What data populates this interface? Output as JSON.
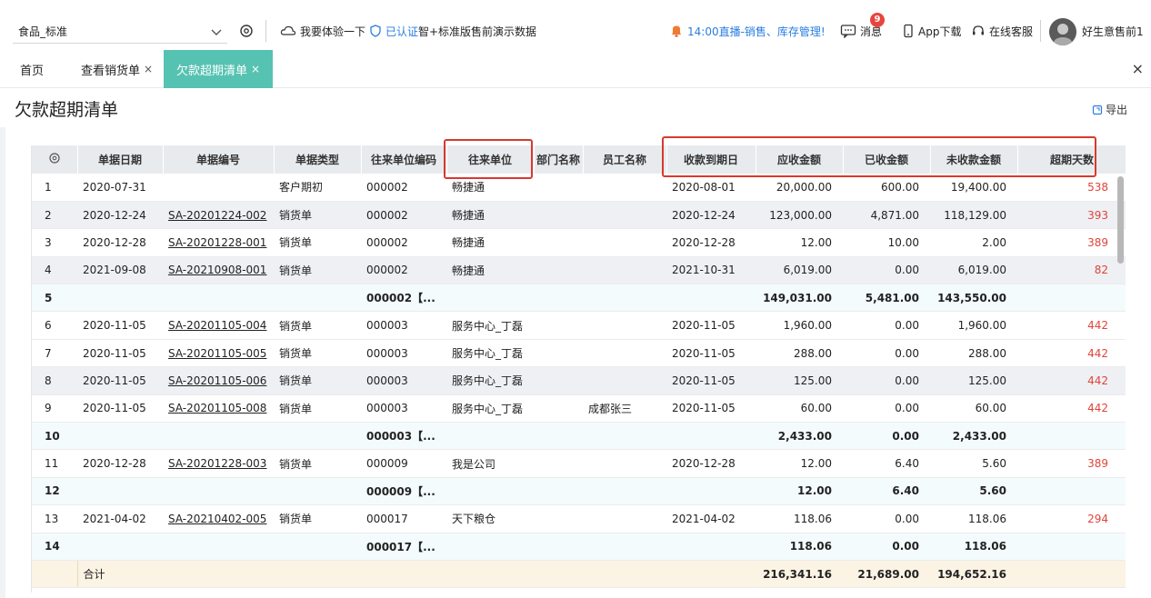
{
  "header": {
    "store_name": "食品_标准",
    "trial": "我要体验一下",
    "certified": "已认证",
    "version": "智+标准版售前演示数据",
    "notice": "14:00直播-销售、库存管理!",
    "messages": "消息",
    "messages_badge": "9",
    "app_download": "App下载",
    "online_service": "在线客服",
    "user_name": "好生意售前1"
  },
  "tabs": [
    {
      "label": "首页"
    },
    {
      "label": "查看销货单",
      "close": "×"
    },
    {
      "label": "欠款超期清单",
      "close": "×"
    }
  ],
  "tabs_close_all": "×",
  "page": {
    "title": "欠款超期清单",
    "export": "导出"
  },
  "table": {
    "columns": [
      "单据日期",
      "单据编号",
      "单据类型",
      "往来单位编码",
      "往来单位",
      "部门名称",
      "员工名称",
      "收款到期日",
      "应收金额",
      "已收金额",
      "未收款金额",
      "超期天数"
    ],
    "rows": [
      {
        "no": "1",
        "date": "2020-07-31",
        "code": "",
        "type": "客户期初",
        "unit_code": "000002",
        "unit": "畅捷通",
        "dept": "",
        "emp": "",
        "due": "2020-08-01",
        "receivable": "20,000.00",
        "received": "600.00",
        "unreceived": "19,400.00",
        "days": "538",
        "kind": "odd"
      },
      {
        "no": "2",
        "date": "2020-12-24",
        "code": "SA-20201224-002",
        "type": "销货单",
        "unit_code": "000002",
        "unit": "畅捷通",
        "dept": "",
        "emp": "",
        "due": "2020-12-24",
        "receivable": "123,000.00",
        "received": "4,871.00",
        "unreceived": "118,129.00",
        "days": "393",
        "kind": "even"
      },
      {
        "no": "3",
        "date": "2020-12-28",
        "code": "SA-20201228-001",
        "type": "销货单",
        "unit_code": "000002",
        "unit": "畅捷通",
        "dept": "",
        "emp": "",
        "due": "2020-12-28",
        "receivable": "12.00",
        "received": "10.00",
        "unreceived": "2.00",
        "days": "389",
        "kind": "odd"
      },
      {
        "no": "4",
        "date": "2021-09-08",
        "code": "SA-20210908-001",
        "type": "销货单",
        "unit_code": "000002",
        "unit": "畅捷通",
        "dept": "",
        "emp": "",
        "due": "2021-10-31",
        "receivable": "6,019.00",
        "received": "0.00",
        "unreceived": "6,019.00",
        "days": "82",
        "kind": "even"
      },
      {
        "no": "5",
        "date": "",
        "code": "",
        "type": "",
        "unit_code": "000002【...",
        "unit": "",
        "dept": "",
        "emp": "",
        "due": "",
        "receivable": "149,031.00",
        "received": "5,481.00",
        "unreceived": "143,550.00",
        "days": "",
        "kind": "sub"
      },
      {
        "no": "6",
        "date": "2020-11-05",
        "code": "SA-20201105-004",
        "type": "销货单",
        "unit_code": "000003",
        "unit": "服务中心_丁磊",
        "dept": "",
        "emp": "",
        "due": "2020-11-05",
        "receivable": "1,960.00",
        "received": "0.00",
        "unreceived": "1,960.00",
        "days": "442",
        "kind": "odd"
      },
      {
        "no": "7",
        "date": "2020-11-05",
        "code": "SA-20201105-005",
        "type": "销货单",
        "unit_code": "000003",
        "unit": "服务中心_丁磊",
        "dept": "",
        "emp": "",
        "due": "2020-11-05",
        "receivable": "288.00",
        "received": "0.00",
        "unreceived": "288.00",
        "days": "442",
        "kind": "odd"
      },
      {
        "no": "8",
        "date": "2020-11-05",
        "code": "SA-20201105-006",
        "type": "销货单",
        "unit_code": "000003",
        "unit": "服务中心_丁磊",
        "dept": "",
        "emp": "",
        "due": "2020-11-05",
        "receivable": "125.00",
        "received": "0.00",
        "unreceived": "125.00",
        "days": "442",
        "kind": "even"
      },
      {
        "no": "9",
        "date": "2020-11-05",
        "code": "SA-20201105-008",
        "type": "销货单",
        "unit_code": "000003",
        "unit": "服务中心_丁磊",
        "dept": "",
        "emp": "成都张三",
        "due": "2020-11-05",
        "receivable": "60.00",
        "received": "0.00",
        "unreceived": "60.00",
        "days": "442",
        "kind": "odd"
      },
      {
        "no": "10",
        "date": "",
        "code": "",
        "type": "",
        "unit_code": "000003【...",
        "unit": "",
        "dept": "",
        "emp": "",
        "due": "",
        "receivable": "2,433.00",
        "received": "0.00",
        "unreceived": "2,433.00",
        "days": "",
        "kind": "sub"
      },
      {
        "no": "11",
        "date": "2020-12-28",
        "code": "SA-20201228-003",
        "type": "销货单",
        "unit_code": "000009",
        "unit": "我是公司",
        "dept": "",
        "emp": "",
        "due": "2020-12-28",
        "receivable": "12.00",
        "received": "6.40",
        "unreceived": "5.60",
        "days": "389",
        "kind": "odd"
      },
      {
        "no": "12",
        "date": "",
        "code": "",
        "type": "",
        "unit_code": "000009【...",
        "unit": "",
        "dept": "",
        "emp": "",
        "due": "",
        "receivable": "12.00",
        "received": "6.40",
        "unreceived": "5.60",
        "days": "",
        "kind": "sub"
      },
      {
        "no": "13",
        "date": "2021-04-02",
        "code": "SA-20210402-005",
        "type": "销货单",
        "unit_code": "000017",
        "unit": "天下粮仓",
        "dept": "",
        "emp": "",
        "due": "2021-04-02",
        "receivable": "118.06",
        "received": "0.00",
        "unreceived": "118.06",
        "days": "294",
        "kind": "odd"
      },
      {
        "no": "14",
        "date": "",
        "code": "",
        "type": "",
        "unit_code": "000017【...",
        "unit": "",
        "dept": "",
        "emp": "",
        "due": "",
        "receivable": "118.06",
        "received": "0.00",
        "unreceived": "118.06",
        "days": "",
        "kind": "sub"
      }
    ],
    "total": {
      "label": "合计",
      "receivable": "216,341.16",
      "received": "21,689.00",
      "unreceived": "194,652.16"
    }
  },
  "colors": {
    "accent": "#56c2b2",
    "overdue": "#e0443b",
    "highlight_box": "#d8392e"
  }
}
